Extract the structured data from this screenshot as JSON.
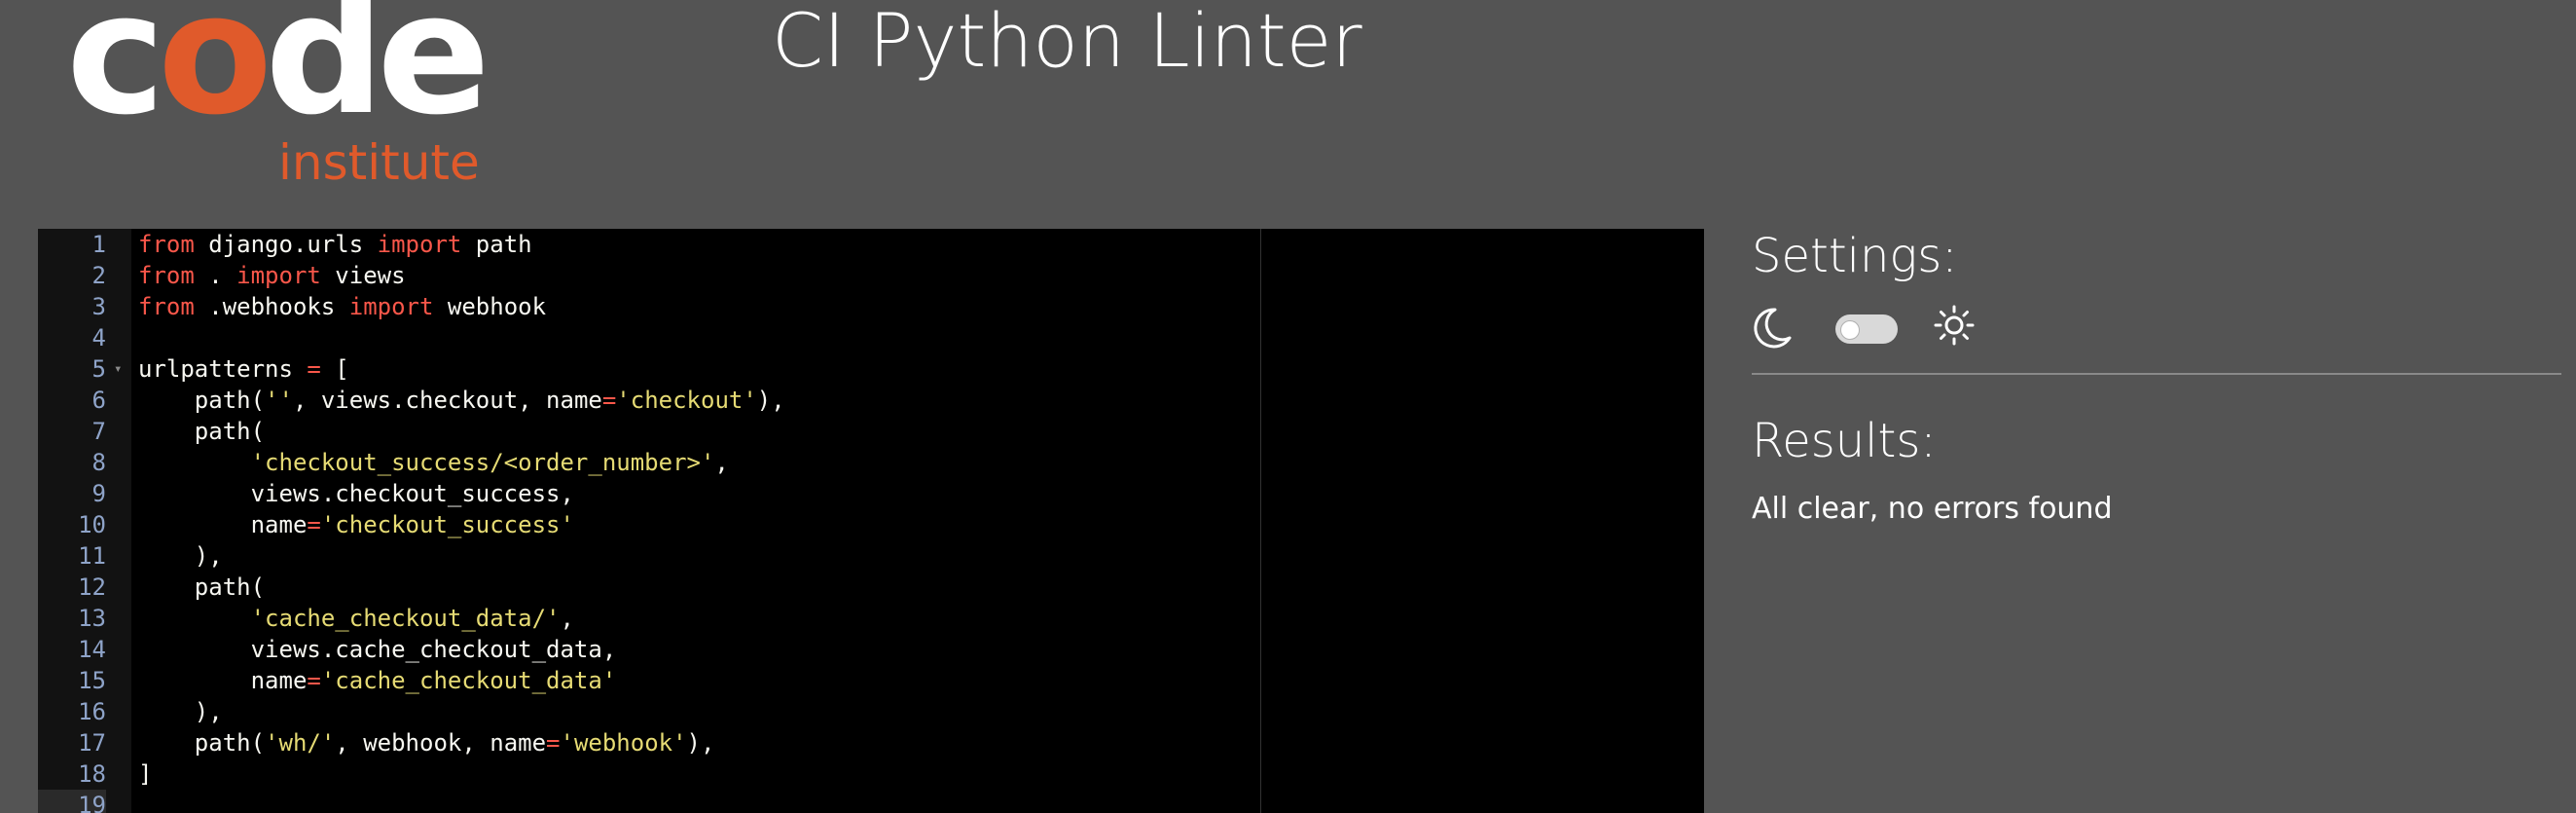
{
  "logo": {
    "word_before": "c",
    "word_accent": "o",
    "word_after": "de",
    "sub": "institute",
    "accent_color": "#e05a2b"
  },
  "title": "CI Python Linter",
  "editor": {
    "lines": [
      {
        "n": "1",
        "tokens": [
          [
            "kw",
            "from"
          ],
          [
            "t",
            " django.urls "
          ],
          [
            "kw",
            "import"
          ],
          [
            "t",
            " path"
          ]
        ]
      },
      {
        "n": "2",
        "tokens": [
          [
            "kw",
            "from"
          ],
          [
            "t",
            " . "
          ],
          [
            "kw",
            "import"
          ],
          [
            "t",
            " views"
          ]
        ]
      },
      {
        "n": "3",
        "tokens": [
          [
            "kw",
            "from"
          ],
          [
            "t",
            " .webhooks "
          ],
          [
            "kw",
            "import"
          ],
          [
            "t",
            " webhook"
          ]
        ]
      },
      {
        "n": "4",
        "tokens": []
      },
      {
        "n": "5",
        "fold": true,
        "tokens": [
          [
            "t",
            "urlpatterns "
          ],
          [
            "op",
            "="
          ],
          [
            "t",
            " ["
          ]
        ]
      },
      {
        "n": "6",
        "tokens": [
          [
            "t",
            "    path("
          ],
          [
            "str",
            "''"
          ],
          [
            "t",
            ", views.checkout, name"
          ],
          [
            "op",
            "="
          ],
          [
            "str",
            "'checkout'"
          ],
          [
            "t",
            "),"
          ]
        ]
      },
      {
        "n": "7",
        "tokens": [
          [
            "t",
            "    path("
          ]
        ]
      },
      {
        "n": "8",
        "tokens": [
          [
            "t",
            "        "
          ],
          [
            "str",
            "'checkout_success/<order_number>'"
          ],
          [
            "t",
            ","
          ]
        ]
      },
      {
        "n": "9",
        "tokens": [
          [
            "t",
            "        views.checkout_success,"
          ]
        ]
      },
      {
        "n": "10",
        "tokens": [
          [
            "t",
            "        name"
          ],
          [
            "op",
            "="
          ],
          [
            "str",
            "'checkout_success'"
          ]
        ]
      },
      {
        "n": "11",
        "tokens": [
          [
            "t",
            "    ),"
          ]
        ]
      },
      {
        "n": "12",
        "tokens": [
          [
            "t",
            "    path("
          ]
        ]
      },
      {
        "n": "13",
        "tokens": [
          [
            "t",
            "        "
          ],
          [
            "str",
            "'cache_checkout_data/'"
          ],
          [
            "t",
            ","
          ]
        ]
      },
      {
        "n": "14",
        "tokens": [
          [
            "t",
            "        views.cache_checkout_data,"
          ]
        ]
      },
      {
        "n": "15",
        "tokens": [
          [
            "t",
            "        name"
          ],
          [
            "op",
            "="
          ],
          [
            "str",
            "'cache_checkout_data'"
          ]
        ]
      },
      {
        "n": "16",
        "tokens": [
          [
            "t",
            "    ),"
          ]
        ]
      },
      {
        "n": "17",
        "tokens": [
          [
            "t",
            "    path("
          ],
          [
            "str",
            "'wh/'"
          ],
          [
            "t",
            ", webhook, name"
          ],
          [
            "op",
            "="
          ],
          [
            "str",
            "'webhook'"
          ],
          [
            "t",
            "),"
          ]
        ]
      },
      {
        "n": "18",
        "tokens": [
          [
            "t",
            "]"
          ]
        ]
      },
      {
        "n": "19",
        "active": true,
        "tokens": []
      }
    ]
  },
  "settings": {
    "title": "Settings:",
    "dark_icon": "moon-icon",
    "light_icon": "sun-icon",
    "theme_toggle_on": false
  },
  "results": {
    "title": "Results:",
    "message": "All clear, no errors found"
  }
}
